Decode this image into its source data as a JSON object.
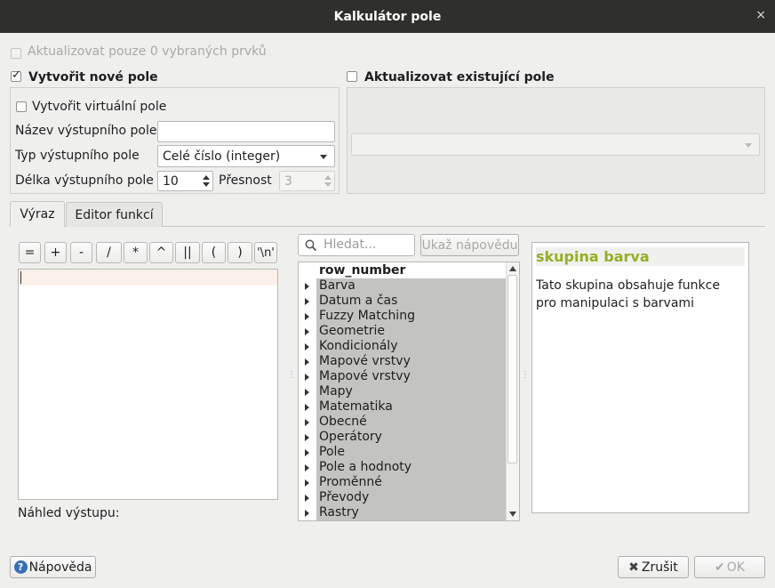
{
  "window": {
    "title": "Kalkulátor pole",
    "close_glyph": "×"
  },
  "update_selected": {
    "label": "Aktualizovat pouze 0 vybraných prvků",
    "checked": false,
    "enabled": false
  },
  "create_new_field": {
    "label": "Vytvořit nové pole",
    "checked": true,
    "virtual_label": "Vytvořit virtuální pole",
    "name_label": "Název výstupního pole",
    "name_value": "",
    "type_label": "Typ výstupního pole",
    "type_value": "Celé číslo (integer)",
    "length_label": "Délka výstupního pole",
    "length_value": "10",
    "precision_label": "Přesnost",
    "precision_value": "3"
  },
  "update_existing": {
    "label": "Aktualizovat existující pole",
    "checked": false,
    "field_value": ""
  },
  "tabs": [
    {
      "label": "Výraz",
      "active": true
    },
    {
      "label": "Editor funkcí",
      "active": false
    }
  ],
  "operators": [
    "=",
    "+",
    "-",
    "/",
    "*",
    "^",
    "||",
    "(",
    ")",
    "'\\n'"
  ],
  "expression": {
    "value": ""
  },
  "preview": {
    "label": "Náhled výstupu:"
  },
  "search": {
    "placeholder": "Hledat...",
    "icon": "search-icon"
  },
  "show_help_button": "Ukaž nápovědu",
  "function_tree": {
    "first_item": "row_number",
    "groups": [
      "Barva",
      "Datum a čas",
      "Fuzzy Matching",
      "Geometrie",
      "Kondicionály",
      "Mapové vrstvy",
      "Mapové vrstvy",
      "Mapy",
      "Matematika",
      "Obecné",
      "Operátory",
      "Pole",
      "Pole a hodnoty",
      "Proměnné",
      "Převody",
      "Rastry"
    ]
  },
  "help_panel": {
    "title": "skupina barva",
    "body": "Tato skupina obsahuje funkce pro manipulaci s barvami",
    "title_color": "#93b023"
  },
  "footer": {
    "help_button": "Nápověda",
    "cancel_button": "Zrušit",
    "ok_button": "OK"
  }
}
